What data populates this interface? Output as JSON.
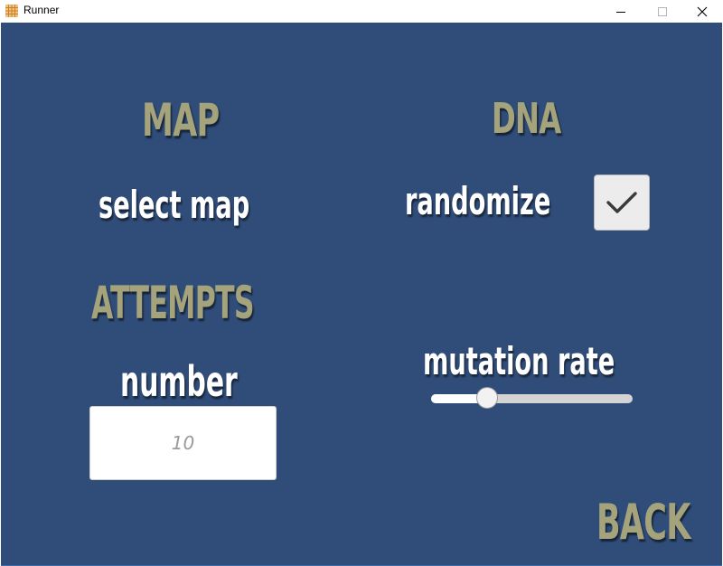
{
  "window": {
    "title": "Runner",
    "minimize_icon": "minimize-icon",
    "maximize_icon": "maximize-icon",
    "close_icon": "close-icon"
  },
  "map": {
    "heading": "MAP",
    "select_label": "select map"
  },
  "dna": {
    "heading": "DNA",
    "randomize_label": "randomize",
    "randomize_checked": true,
    "mutation_label": "mutation rate",
    "mutation_rate": 0.28
  },
  "attempts": {
    "heading": "ATTEMPTS",
    "number_label": "number",
    "number_value": "",
    "number_placeholder": "10"
  },
  "back_label": "BACK",
  "colors": {
    "background": "#304d79",
    "heading": "#a4a37c",
    "label": "#ffffff"
  }
}
